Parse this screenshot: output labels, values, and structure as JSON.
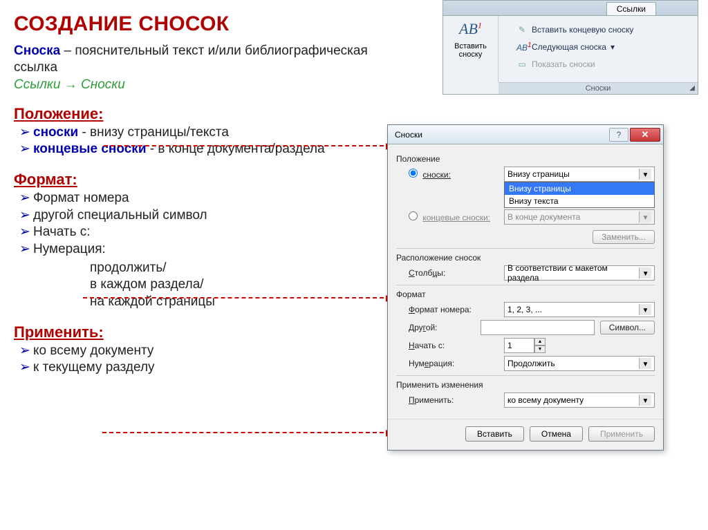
{
  "slide": {
    "title": "СОЗДАНИЕ СНОСОК",
    "def_bold": "Сноска",
    "def_rest": " – пояснительный текст и/или библиографическая ссылка",
    "path": "Ссылки → Сноски",
    "h_position": "Положение:",
    "pos_item1_b": "сноски",
    "pos_item1_r": " - внизу страницы/текста",
    "pos_item2_b": "концевые сноски",
    "pos_item2_r": " - в конце документа/раздела",
    "h_format": "Формат:",
    "fmt1": "Формат номера",
    "fmt2": "другой специальный символ",
    "fmt3": "Начать с:",
    "fmt4": "Нумерация:",
    "sub1": "продолжить/",
    "sub2": "в каждом раздела/",
    "sub3": "на каждой страницы",
    "h_apply": "Применить:",
    "ap1": "ко всему документу",
    "ap2": "к текущему разделу"
  },
  "ribbon": {
    "tab": "Ссылки",
    "big_icon": "AB",
    "big_label": "Вставить сноску",
    "r1": "Вставить концевую сноску",
    "r2": "Следующая сноска",
    "r3": "Показать сноски",
    "group": "Сноски"
  },
  "dialog": {
    "title": "Сноски",
    "grp_position": "Положение",
    "radio_footnotes": "сноски:",
    "footnotes_value": "Внизу страницы",
    "dropdown_opt1": "Внизу страницы",
    "dropdown_opt2": "Внизу текста",
    "radio_endnotes": "концевые сноски:",
    "endnotes_value": "В конце документа",
    "btn_replace": "Заменить...",
    "grp_layout": "Расположение сносок",
    "lbl_columns": "Столбцы:",
    "columns_value": "В соответствии с макетом раздела",
    "grp_format": "Формат",
    "lbl_numfmt": "Формат номера:",
    "numfmt_value": "1, 2, 3, ...",
    "lbl_other": "Другой:",
    "btn_symbol": "Символ...",
    "lbl_start": "Начать с:",
    "start_value": "1",
    "lbl_numbering": "Нумерация:",
    "numbering_value": "Продолжить",
    "grp_apply": "Применить изменения",
    "lbl_apply": "Применить:",
    "apply_value": "ко всему документу",
    "btn_insert": "Вставить",
    "btn_cancel": "Отмена",
    "btn_apply": "Применить"
  }
}
